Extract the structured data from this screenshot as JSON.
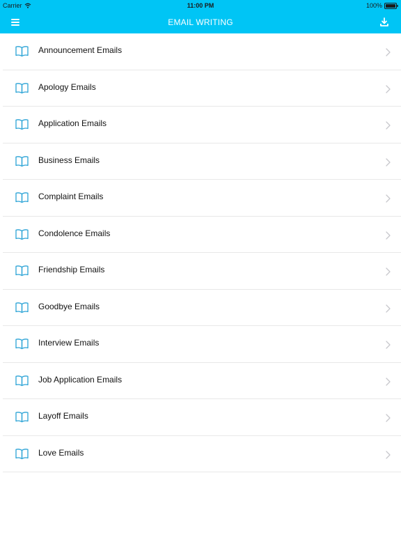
{
  "status": {
    "carrier": "Carrier",
    "time": "11:00 PM",
    "battery": "100%"
  },
  "nav": {
    "title": "EMAIL WRITING",
    "left_icon": "menu-icon",
    "right_icon": "download-icon"
  },
  "colors": {
    "accent": "#00c5f5",
    "icon": "#2ba3d6",
    "divider": "#e8e8e8",
    "chevron": "#c7c7cc"
  },
  "list": {
    "items": [
      {
        "label": "Announcement Emails"
      },
      {
        "label": "Apology Emails"
      },
      {
        "label": "Application Emails"
      },
      {
        "label": "Business Emails"
      },
      {
        "label": "Complaint Emails"
      },
      {
        "label": "Condolence Emails"
      },
      {
        "label": "Friendship Emails"
      },
      {
        "label": "Goodbye Emails"
      },
      {
        "label": "Interview Emails"
      },
      {
        "label": "Job Application Emails"
      },
      {
        "label": "Layoff Emails"
      },
      {
        "label": "Love Emails"
      }
    ]
  }
}
